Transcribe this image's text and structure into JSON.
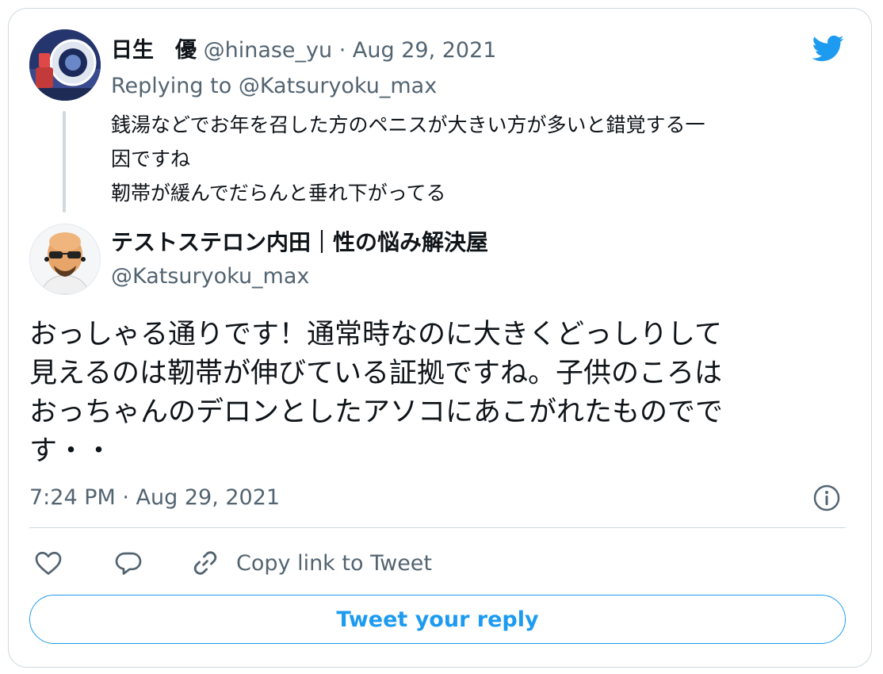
{
  "parent_tweet": {
    "author_name": "日生　優",
    "author_handle": "@hinase_yu",
    "separator": "·",
    "date": "Aug 29, 2021",
    "replying_prefix": "Replying to ",
    "replying_to": "@Katsuryoku_max",
    "text_lines": [
      "銭湯などでお年を召した方のペニスが大きい方が多いと錯覚する一",
      "因ですね",
      "靭帯が緩んでだらんと垂れ下がってる"
    ]
  },
  "reply_tweet": {
    "author_name": "テストステロン内田｜性の悩み解決屋",
    "author_handle": "@Katsuryoku_max",
    "text_lines": [
      "おっしゃる通りです！通常時なのに大きくどっしりして",
      "見えるのは靭帯が伸びている証拠ですね。子供のころは",
      "おっちゃんのデロンとしたアソコにあこがれたものでで",
      "す・・"
    ],
    "timestamp": "7:24 PM · Aug 29, 2021"
  },
  "actions": {
    "copy_link_label": "Copy link to Tweet",
    "reply_button_label": "Tweet your reply"
  },
  "icons": {
    "brand": "twitter-bird-icon",
    "info": "info-icon",
    "like": "heart-icon",
    "reply": "reply-bubble-icon",
    "link": "link-icon"
  },
  "colors": {
    "brand_blue": "#1d9bf0",
    "secondary_text": "#536471",
    "border": "#cfd9de"
  }
}
